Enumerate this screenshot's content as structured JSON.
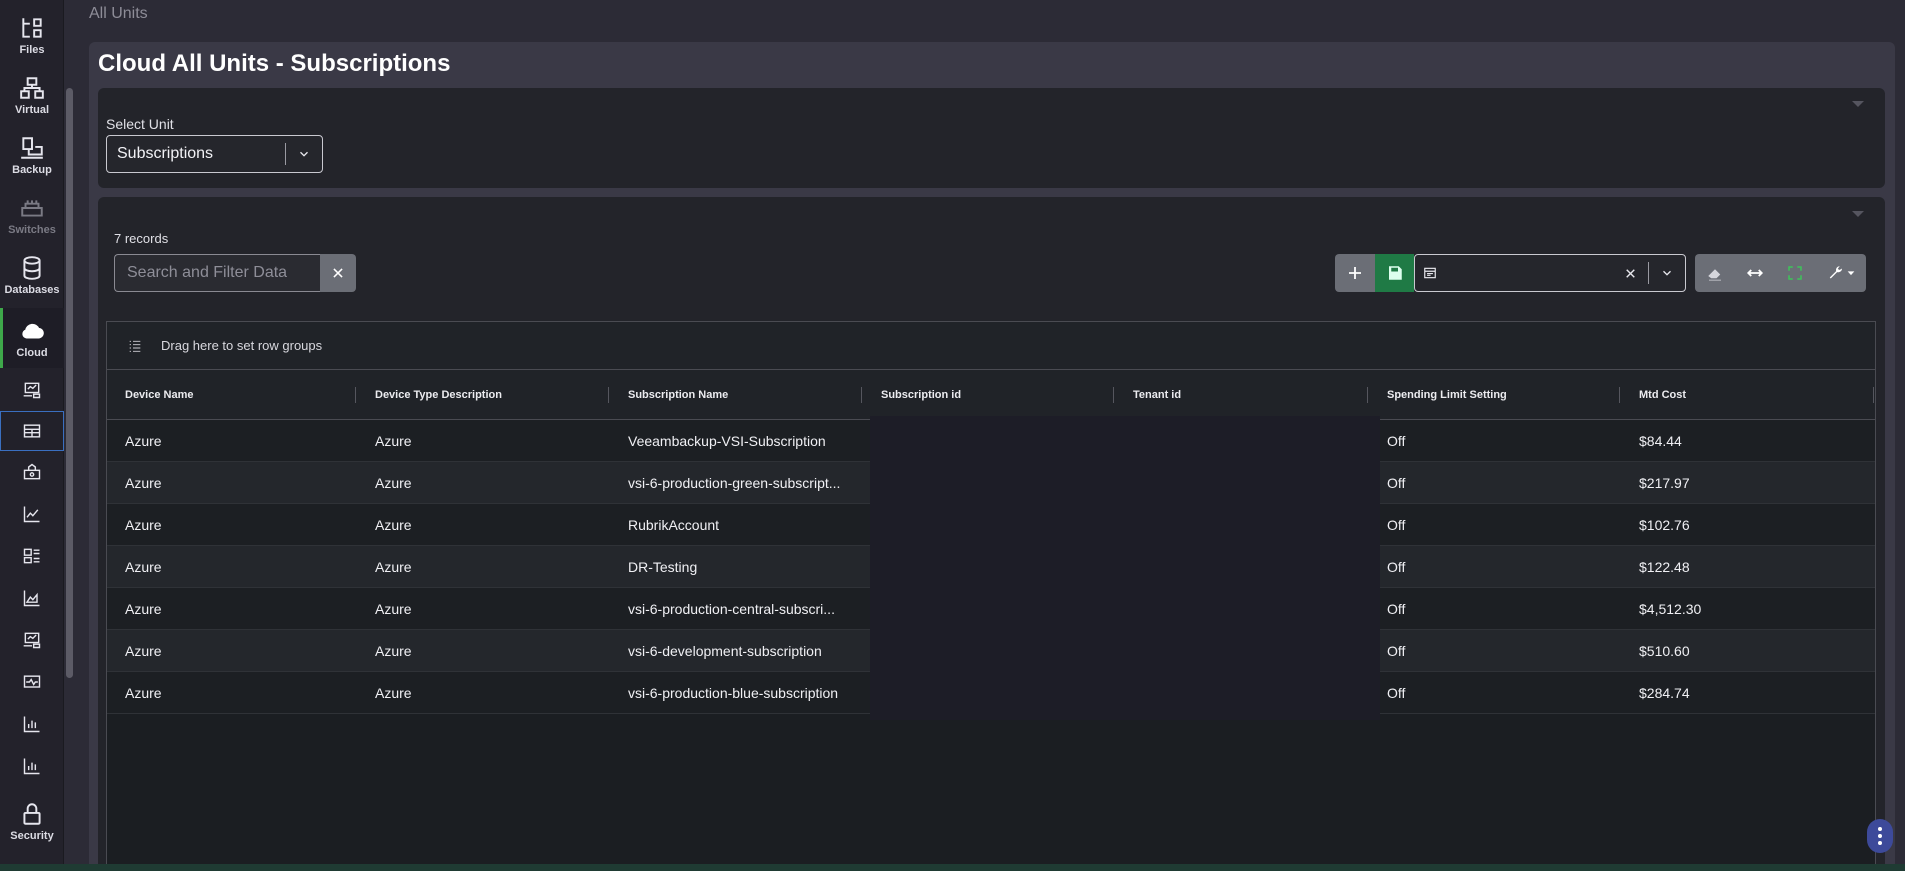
{
  "breadcrumb": "All Units",
  "page_title": "Cloud All Units - Subscriptions",
  "sidebar": {
    "items": [
      {
        "label": "Files",
        "icon": "files-icon"
      },
      {
        "label": "Virtual",
        "icon": "network-icon"
      },
      {
        "label": "Backup",
        "icon": "backup-icon"
      },
      {
        "label": "Switches",
        "icon": "switch-icon"
      },
      {
        "label": "Databases",
        "icon": "database-icon"
      },
      {
        "label": "Cloud",
        "icon": "cloud-icon"
      },
      {
        "label": "Security",
        "icon": "lock-icon"
      }
    ],
    "sub_icons": [
      "report-icon",
      "table-icon",
      "cash-icon",
      "line-chart-icon",
      "dashboard-icon",
      "area-chart-icon",
      "report-icon",
      "monitor-chart-icon",
      "bar-chart-icon",
      "bar-chart-icon"
    ]
  },
  "unit_selector": {
    "label": "Select Unit",
    "value": "Subscriptions"
  },
  "grid": {
    "records_text": "7 records",
    "search_placeholder": "Search and Filter Data",
    "group_bar_text": "Drag here to set row groups",
    "columns": [
      "Device Name",
      "Device Type Description",
      "Subscription Name",
      "Subscription id",
      "Tenant id",
      "Spending Limit Setting",
      "Mtd Cost"
    ],
    "rows": [
      {
        "device": "Azure",
        "type": "Azure",
        "subscription": "Veeambackup-VSI-Subscription",
        "sub_id": "",
        "tenant": "",
        "limit": "Off",
        "cost": "$84.44"
      },
      {
        "device": "Azure",
        "type": "Azure",
        "subscription": "vsi-6-production-green-subscript...",
        "sub_id": "",
        "tenant": "",
        "limit": "Off",
        "cost": "$217.97"
      },
      {
        "device": "Azure",
        "type": "Azure",
        "subscription": "RubrikAccount",
        "sub_id": "",
        "tenant": "",
        "limit": "Off",
        "cost": "$102.76"
      },
      {
        "device": "Azure",
        "type": "Azure",
        "subscription": "DR-Testing",
        "sub_id": "",
        "tenant": "",
        "limit": "Off",
        "cost": "$122.48"
      },
      {
        "device": "Azure",
        "type": "Azure",
        "subscription": "vsi-6-production-central-subscri...",
        "sub_id": "",
        "tenant": "",
        "limit": "Off",
        "cost": "$4,512.30"
      },
      {
        "device": "Azure",
        "type": "Azure",
        "subscription": "vsi-6-development-subscription",
        "sub_id": "",
        "tenant": "",
        "limit": "Off",
        "cost": "$510.60"
      },
      {
        "device": "Azure",
        "type": "Azure",
        "subscription": "vsi-6-production-blue-subscription",
        "sub_id": "",
        "tenant": "",
        "limit": "Off",
        "cost": "$284.74"
      }
    ]
  },
  "colors": {
    "accent_green": "#3ea84a",
    "save_button": "#1f7a45",
    "add_button": "#6b6e76"
  }
}
